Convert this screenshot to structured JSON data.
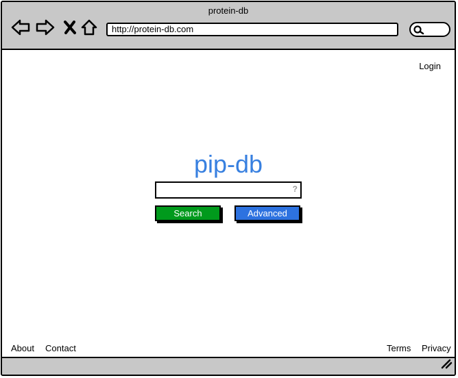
{
  "window": {
    "title": "protein-db",
    "url": "http://protein-db.com"
  },
  "toolbar": {
    "icons": [
      "back-arrow-icon",
      "forward-arrow-icon",
      "close-x-icon",
      "home-icon",
      "search-icon"
    ]
  },
  "header": {
    "login": "Login"
  },
  "main": {
    "logo": "pip-db",
    "search_value": "",
    "help_glyph": "?",
    "search_button": "Search",
    "advanced_button": "Advanced"
  },
  "footer": {
    "about": "About",
    "contact": "Contact",
    "terms": "Terms",
    "privacy": "Privacy"
  },
  "colors": {
    "logo": "#3880e0",
    "search_button": "#009a1c",
    "advanced_button": "#2d72e0",
    "chrome": "#c8c8c8"
  }
}
